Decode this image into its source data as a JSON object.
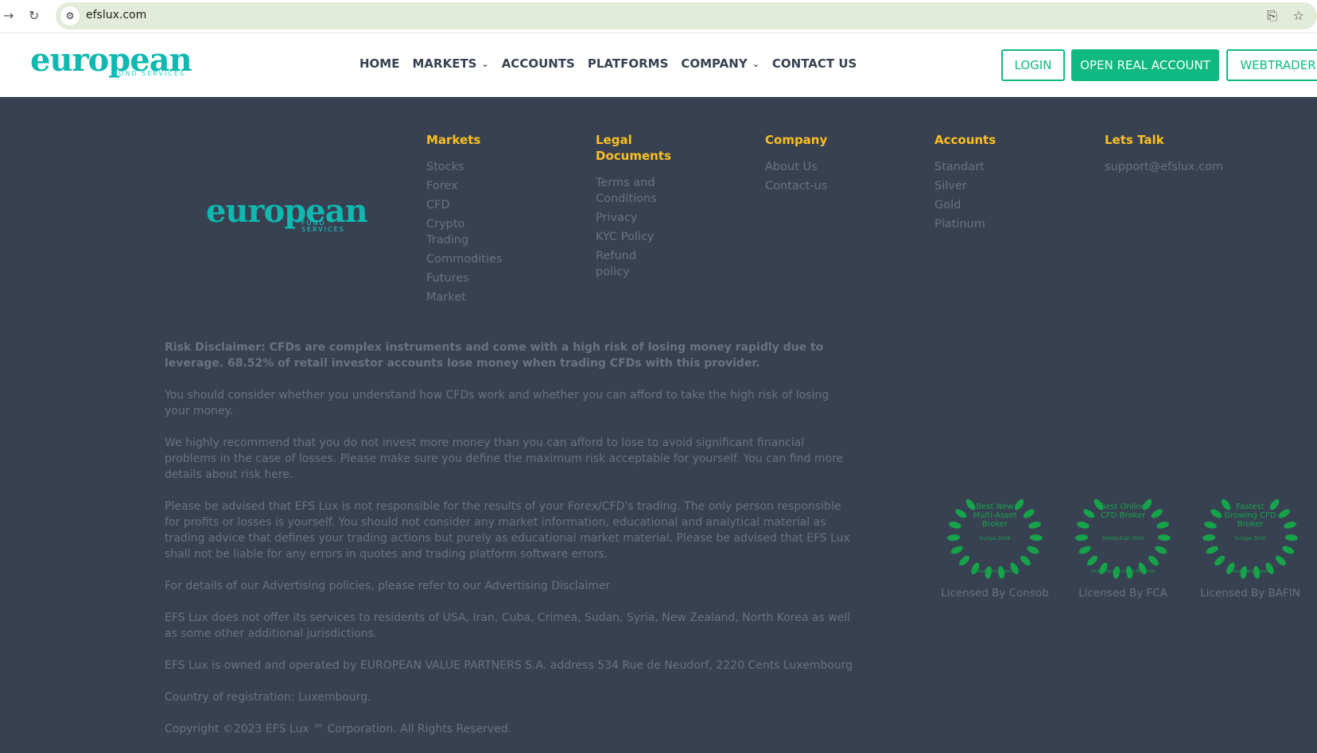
{
  "browser": {
    "url": "efslux.com"
  },
  "logo": {
    "main": "european",
    "sub": "FUND SERVICES"
  },
  "nav": [
    "HOME",
    "MARKETS",
    "ACCOUNTS",
    "PLATFORMS",
    "COMPANY",
    "CONTACT US"
  ],
  "buttons": {
    "login": "LOGIN",
    "open": "OPEN REAL ACCOUNT",
    "webtrader": "WEBTRADER"
  },
  "footer": {
    "markets": {
      "title": "Markets",
      "items": [
        "Stocks",
        "Forex",
        "CFD",
        "Crypto Trading",
        "Commodities",
        "Futures",
        "Market"
      ]
    },
    "legal": {
      "title": "Legal Documents",
      "items": [
        "Terms and Conditions",
        "Privacy",
        "KYC Policy",
        "Refund policy"
      ]
    },
    "company": {
      "title": "Company",
      "items": [
        "About Us",
        "Contact-us"
      ]
    },
    "accounts": {
      "title": "Accounts",
      "items": [
        "Standart",
        "Silver",
        "Gold",
        "Platinum"
      ]
    },
    "talk": {
      "title": "Lets Talk",
      "items": [
        "support@efslux.com"
      ]
    }
  },
  "disclaimer": [
    "Risk Disclaimer: CFDs are complex instruments and come with a high risk of losing money rapidly due to leverage. 68.52% of retail investor accounts lose money when trading CFDs with this provider.",
    "You should consider whether you understand how CFDs work and whether you can afford to take the high risk of losing your money.",
    "We highly recommend that you do not invest more money than you can afford to lose to avoid significant financial problems in the case of losses. Please make sure you define the maximum risk acceptable for yourself. You can find more details about risk here.",
    "Please be advised that EFS Lux is not responsible for the results of your Forex/CFD's trading. The only person responsible for profits or losses is yourself. You should not consider any market information, educational and analytical material as trading advice that defines your trading actions but purely as educational market material. Please be advised that EFS Lux shall not be liable for any errors in quotes and trading platform software errors.",
    "For details of our Advertising policies, please refer to our Advertising Disclaimer",
    "EFS Lux does not offer its services to residents of USA, Iran, Cuba, Crimea,  Sudan, Syria, New Zealand, North Korea as well as some other additional jurisdictions.",
    "EFS Lux is owned and operated by EUROPEAN VALUE PARTNERS S.A. address 534 Rue de Neudorf, 2220 Cents Luxembourg",
    "Country of registration: Luxembourg.",
    "Copyright ©2023 EFS Lux ™ Corporation. All Rights Reserved."
  ],
  "awards": [
    {
      "title": "Best New Multi-Asset Broker",
      "year": "Europe 2018",
      "org": "Global Brands Awards",
      "label": "Licensed By Consob"
    },
    {
      "title": "Best Online CFD Broker",
      "year": "Middle East 2018",
      "org": "International Business Magazine",
      "label": "Licensed By FCA"
    },
    {
      "title": "Fastest Growing CFD Broker",
      "year": "Europe 2018",
      "org": "Global Brands Awards",
      "label": "Licensed By BAFIN"
    }
  ],
  "colors": {
    "accent": "#10b981",
    "heading": "#fbbf24",
    "bg": "#374151"
  }
}
